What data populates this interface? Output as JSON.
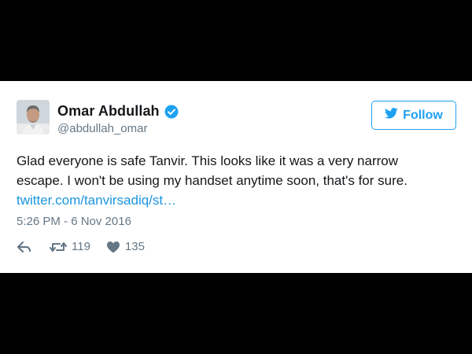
{
  "tweet": {
    "author": {
      "name": "Omar Abdullah",
      "handle": "@abdullah_omar",
      "verified": true
    },
    "follow_button": {
      "label": "Follow",
      "icon": "twitter-bird-icon"
    },
    "text_lines": [
      "Glad everyone is safe Tanvir. This looks like it was a very narrow",
      "escape. I won't be using my handset anytime soon, that's for sure."
    ],
    "link": "twitter.com/tanvirsadiq/st…",
    "timestamp": "5:26 PM - 6 Nov 2016",
    "actions": {
      "reply_icon": "reply-icon",
      "retweet_icon": "retweet-icon",
      "retweet_count": "119",
      "like_icon": "heart-icon",
      "like_count": "135"
    }
  },
  "colors": {
    "accent": "#1da1f2",
    "link": "#1b95e0",
    "text": "#14171a",
    "muted": "#657786",
    "background_bars": "#000000"
  }
}
